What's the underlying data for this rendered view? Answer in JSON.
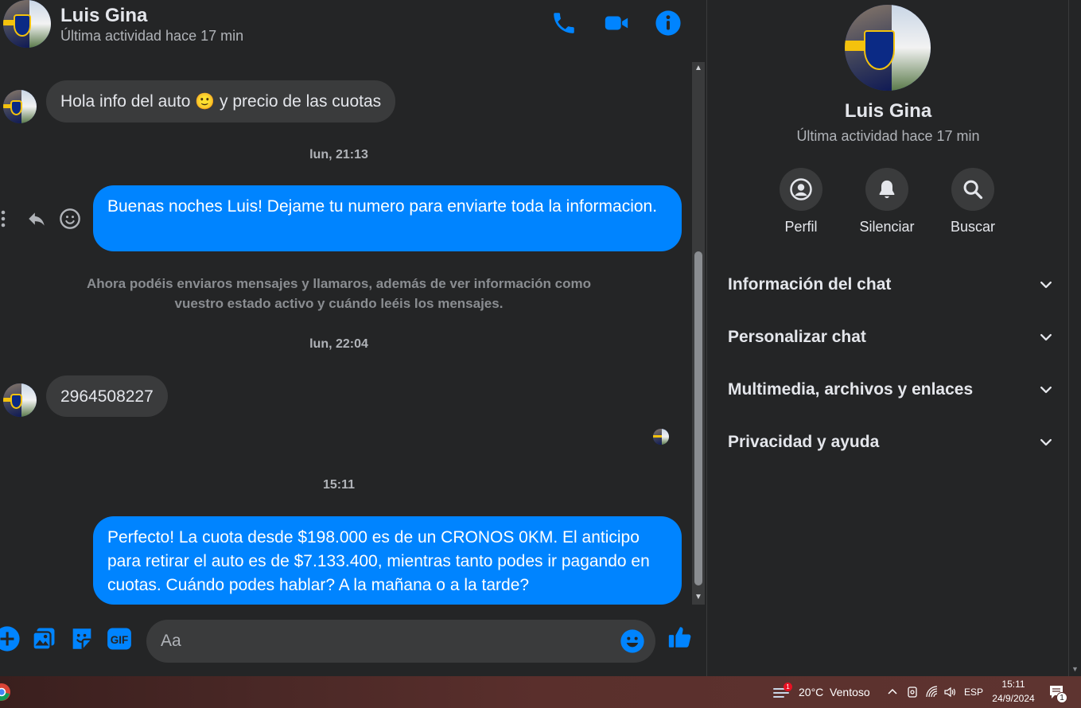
{
  "contact": {
    "name": "Luis Gina",
    "status": "Última actividad hace 17 min"
  },
  "header": {
    "call_icon": "phone-icon",
    "video_icon": "video-camera-icon",
    "info_icon": "info-icon"
  },
  "messages": {
    "m1": {
      "text_a": "Hola info del auto ",
      "emoji": "🙂",
      "text_b": " y precio de las cuotas"
    },
    "ts1": "lun, 21:13",
    "m2": "Buenas noches Luis! Dejame tu numero para enviarte toda la informacion.",
    "notice": "Ahora podéis enviaros mensajes y llamaros, además de ver información como vuestro estado activo y cuándo leéis los mensajes.",
    "ts2": "lun, 22:04",
    "m3": "2964508227",
    "ts3": "15:11",
    "m4": "Perfecto! La cuota desde $198.000 es de un CRONOS 0KM. El anticipo para retirar el auto es de $7.133.400, mientras tanto podes ir pagando en cuotas. Cuándo podes hablar? A la mañana o a la tarde?"
  },
  "composer": {
    "placeholder": "Aa",
    "value": ""
  },
  "panel": {
    "name": "Luis Gina",
    "status": "Última actividad hace 17 min",
    "buttons": [
      {
        "label": "Perfil",
        "icon": "profile-icon"
      },
      {
        "label": "Silenciar",
        "icon": "bell-icon"
      },
      {
        "label": "Buscar",
        "icon": "search-icon"
      }
    ],
    "sections": [
      {
        "label": "Información del chat"
      },
      {
        "label": "Personalizar chat"
      },
      {
        "label": "Multimedia, archivos y enlaces"
      },
      {
        "label": "Privacidad y ayuda"
      }
    ]
  },
  "taskbar": {
    "weather_badge": "1",
    "weather": "20°C  Ventoso",
    "language": "ESP",
    "time": "15:11",
    "date": "24/9/2024",
    "notification_count": "1"
  },
  "colors": {
    "accent": "#0084ff",
    "background": "#242526",
    "bubble_in": "#3a3b3c"
  }
}
